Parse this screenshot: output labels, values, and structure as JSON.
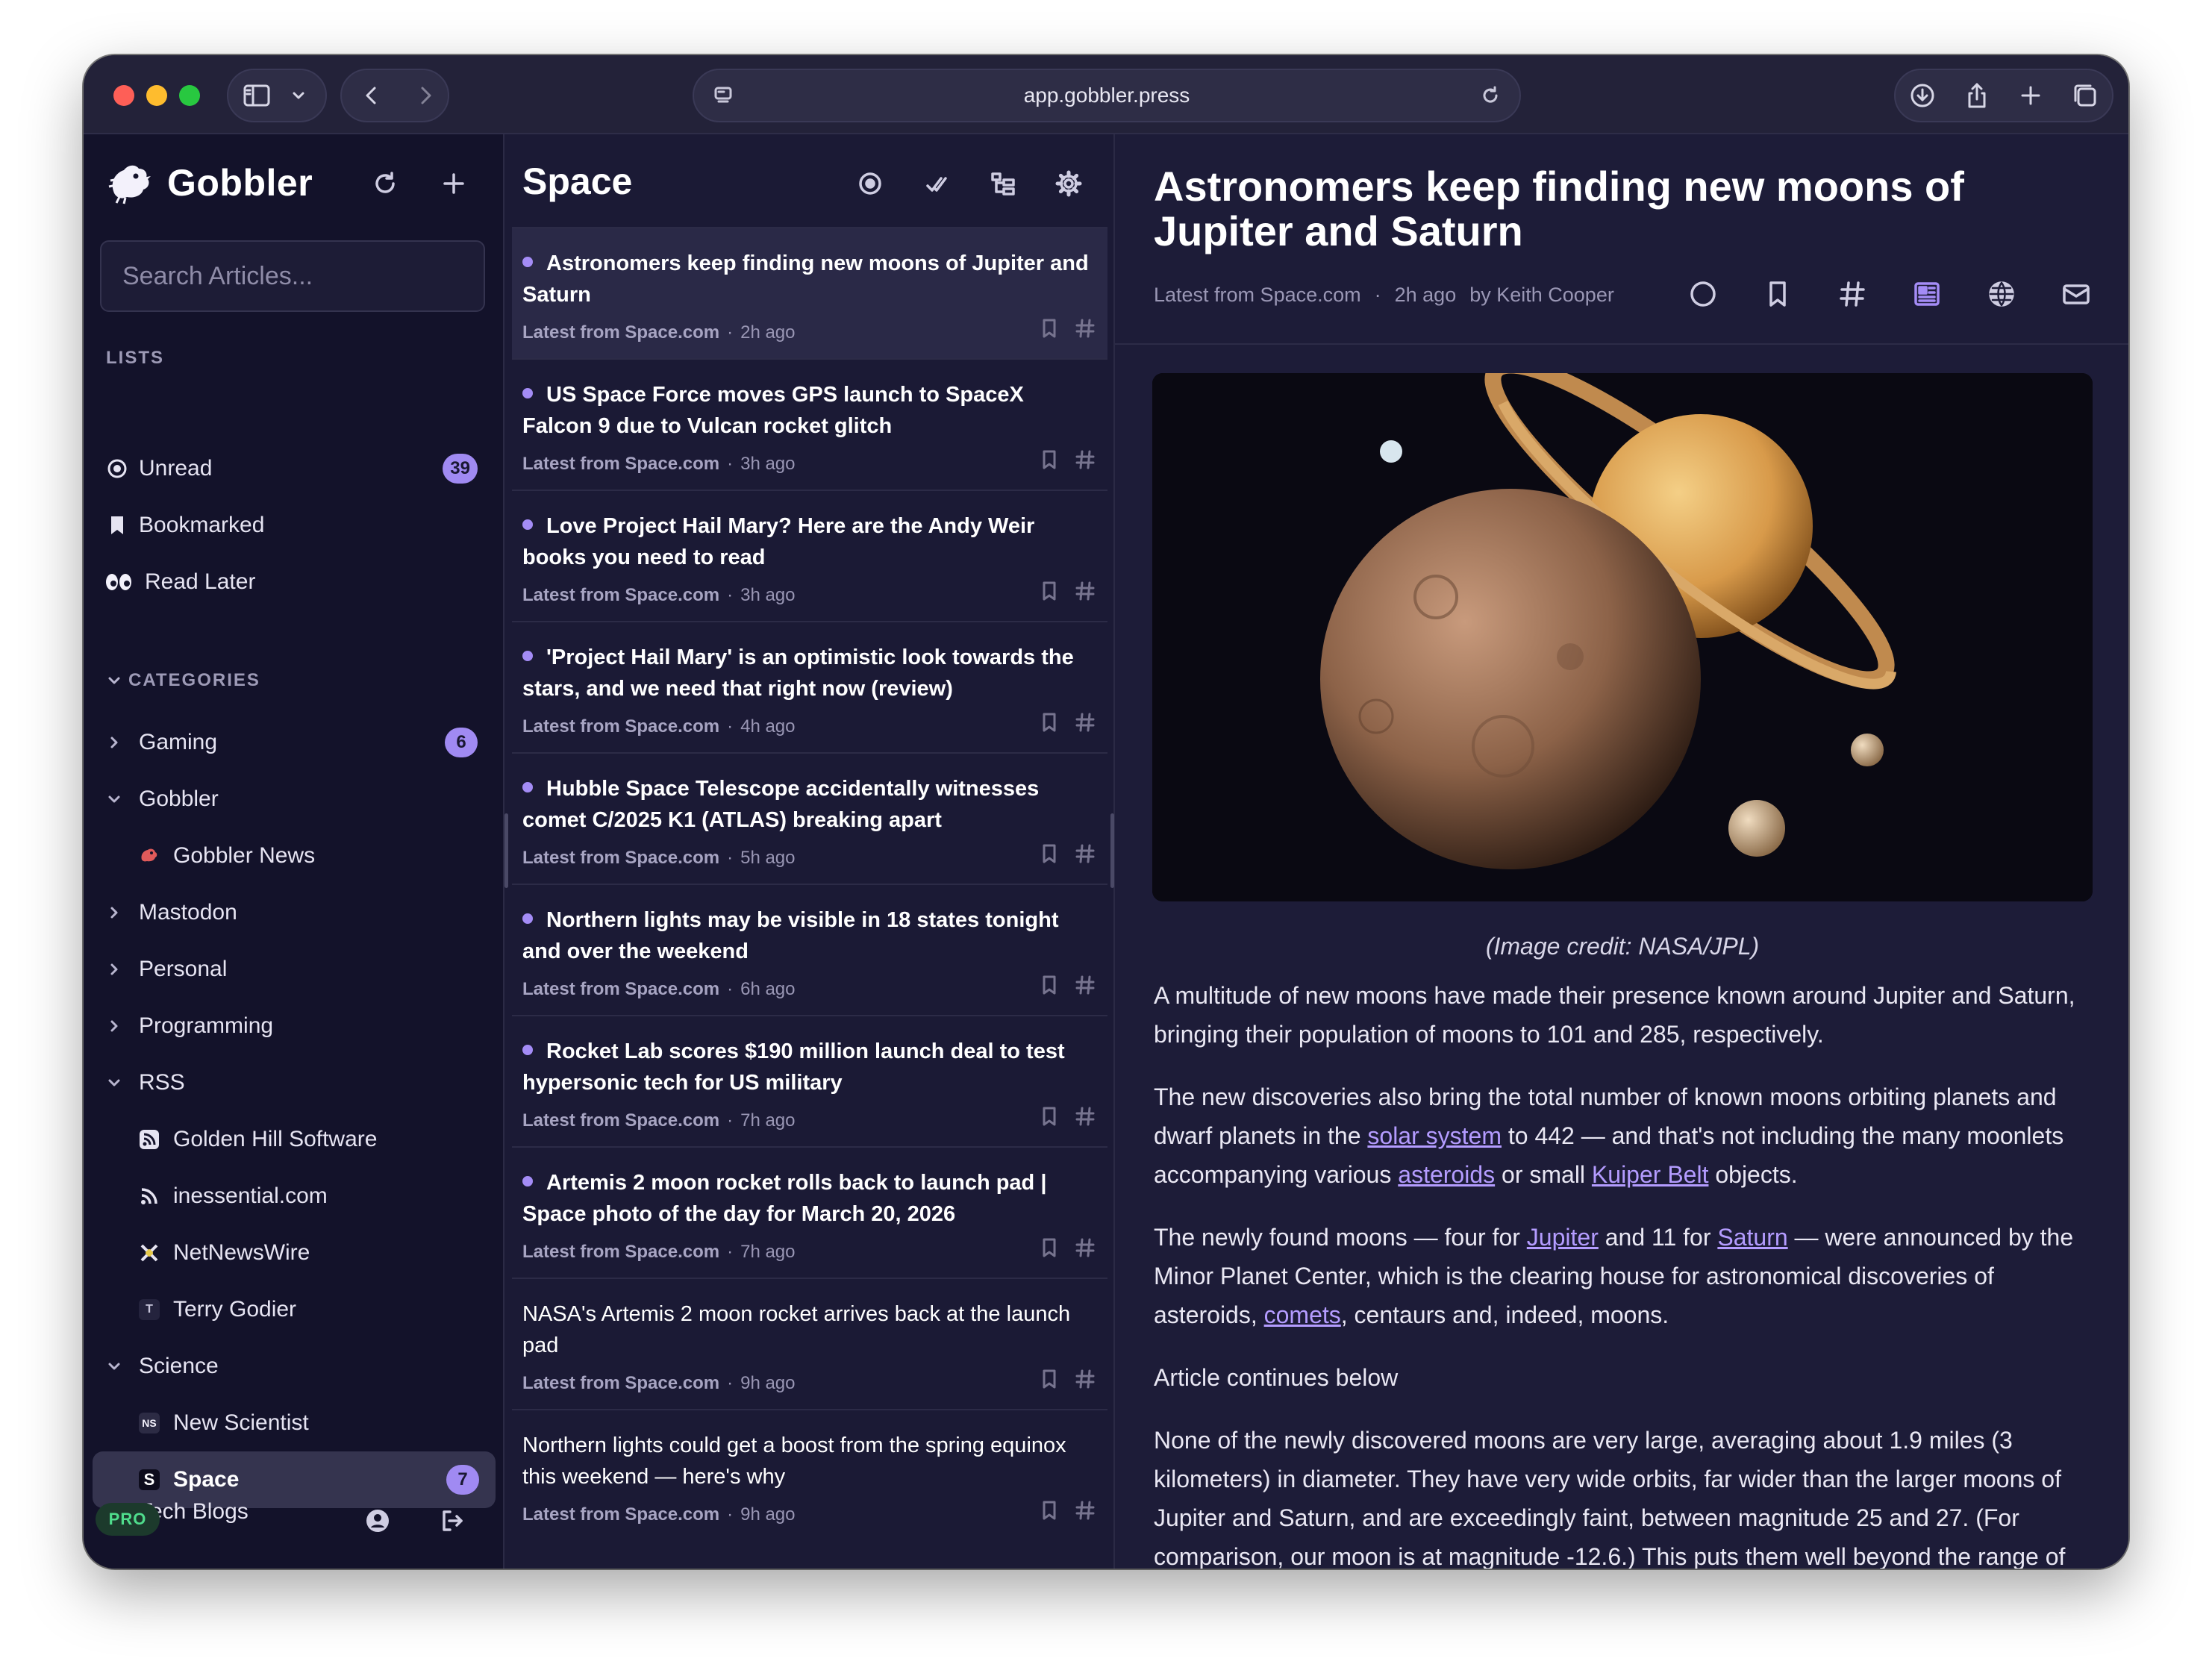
{
  "browser": {
    "url": "app.gobbler.press"
  },
  "sidebar": {
    "app_name": "Gobbler",
    "search_placeholder": "Search Articles...",
    "lists_label": "LISTS",
    "lists": [
      {
        "label": "Unread",
        "count": "39",
        "icon": "unread-circle-icon"
      },
      {
        "label": "Bookmarked",
        "icon": "bookmark-icon"
      },
      {
        "label": "Read Later",
        "icon": "eyes-icon"
      }
    ],
    "categories_label": "CATEGORIES",
    "categories": [
      {
        "label": "Gaming",
        "count": "6",
        "expanded": false
      },
      {
        "label": "Gobbler",
        "expanded": true
      },
      {
        "label": "Gobbler News",
        "feed": true
      },
      {
        "label": "Mastodon",
        "expanded": false
      },
      {
        "label": "Personal",
        "expanded": false
      },
      {
        "label": "Programming",
        "expanded": false
      },
      {
        "label": "RSS",
        "expanded": true
      },
      {
        "label": "Golden Hill Software",
        "feed": true
      },
      {
        "label": "inessential.com",
        "feed": true
      },
      {
        "label": "NetNewsWire",
        "feed": true
      },
      {
        "label": "Terry Godier",
        "feed": true,
        "feed_icon_text": "T"
      },
      {
        "label": "Science",
        "expanded": true
      },
      {
        "label": "New Scientist",
        "feed": true,
        "feed_icon_text": "NS"
      },
      {
        "label": "Space",
        "feed": true,
        "feed_icon_text": "S",
        "count": "7",
        "selected": true
      },
      {
        "label": "Tech Blogs",
        "expanded": true
      }
    ],
    "pro_label": "PRO"
  },
  "list": {
    "title": "Space",
    "articles": [
      {
        "title": "Astronomers keep finding new moons of Jupiter and Saturn",
        "source": "Latest from Space.com",
        "time": "2h ago",
        "unread": true
      },
      {
        "title": "US Space Force moves GPS launch to SpaceX Falcon 9 due to Vulcan rocket glitch",
        "source": "Latest from Space.com",
        "time": "3h ago",
        "unread": true
      },
      {
        "title": "Love Project Hail Mary? Here are the Andy Weir books you need to read",
        "source": "Latest from Space.com",
        "time": "3h ago",
        "unread": true
      },
      {
        "title": "'Project Hail Mary' is an optimistic look towards the stars, and we need that right now (review)",
        "source": "Latest from Space.com",
        "time": "4h ago",
        "unread": true
      },
      {
        "title": "Hubble Space Telescope accidentally witnesses comet C/2025 K1 (ATLAS) breaking apart",
        "source": "Latest from Space.com",
        "time": "5h ago",
        "unread": true
      },
      {
        "title": "Northern lights may be visible in 18 states tonight and over the weekend",
        "source": "Latest from Space.com",
        "time": "6h ago",
        "unread": true
      },
      {
        "title": "Rocket Lab scores $190 million launch deal to test hypersonic tech for US military",
        "source": "Latest from Space.com",
        "time": "7h ago",
        "unread": true
      },
      {
        "title": "Artemis 2 moon rocket rolls back to launch pad | Space photo of the day for March 20, 2026",
        "source": "Latest from Space.com",
        "time": "7h ago",
        "unread": true
      },
      {
        "title": "NASA's Artemis 2 moon rocket arrives back at the launch pad",
        "source": "Latest from Space.com",
        "time": "9h ago",
        "unread": false
      },
      {
        "title": "Northern lights could get a boost from the spring equinox this weekend — here's why",
        "source": "Latest from Space.com",
        "time": "9h ago",
        "unread": false
      }
    ]
  },
  "reader": {
    "title": "Astronomers keep finding new moons of Jupiter and Saturn",
    "source": "Latest from Space.com",
    "separator": "·",
    "time": "2h ago",
    "author": "by Keith Cooper",
    "caption": "(Image credit: NASA/JPL)",
    "p1": "A multitude of new moons have made their presence known around Jupiter and Saturn, bringing their population of moons to 101 and 285, respectively.",
    "p2a": "The new discoveries also bring the total number of known moons orbiting planets and dwarf planets in the ",
    "p2_link1": "solar system",
    "p2b": " to 442 — and that's not including the many moonlets accompanying various ",
    "p2_link2": "asteroids",
    "p2c": " or small ",
    "p2_link3": "Kuiper Belt",
    "p2d": " objects.",
    "p3a": "The newly found moons — four for ",
    "p3_link1": "Jupiter",
    "p3b": " and 11 for ",
    "p3_link2": "Saturn",
    "p3c": " — were announced by the Minor Planet Center, which is the clearing house for astronomical discoveries of asteroids, ",
    "p3_link3": "comets",
    "p3d": ", centaurs and, indeed, moons.",
    "p4": "Article continues below",
    "p5": "None of the newly discovered moons are very large, averaging about 1.9 miles (3 kilometers) in diameter. They have very wide orbits, far wider than the larger moons of Jupiter and Saturn, and are exceedingly faint, between magnitude 25 and 27. (For comparison, our moon is at magnitude -12.6.) This puts them well beyond the range of"
  },
  "colors": {
    "accent": "#a48cf6",
    "sidebar_bg": "#13122a",
    "list_bg": "#1b1a35",
    "reader_bg": "#1d1c38",
    "link": "#b49cff",
    "pro_green": "#4fdd8c"
  }
}
